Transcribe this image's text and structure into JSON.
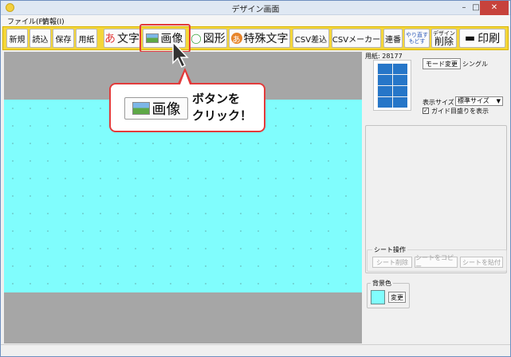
{
  "window": {
    "title": "デザイン画面",
    "minimize": "–",
    "maximize": "□",
    "close": "✕"
  },
  "menu": [
    "ファイル(F)",
    "情報(I)"
  ],
  "toolbar": {
    "new": "新規",
    "load": "読込",
    "save": "保存",
    "paper": "用紙",
    "text_icon": "あ",
    "text": "文字",
    "image": "画像",
    "shape_icon": "◯",
    "shape": "図形",
    "special_icon": "あ",
    "special_text": "特殊文字",
    "csv_merge": "CSV差込",
    "csv_maker": "CSVメーカー",
    "serial": "連番",
    "redo": "やり直す",
    "undo": "もどす",
    "design_label": "デザイン",
    "delete": "削除",
    "print_icon": "▬",
    "print": "印刷"
  },
  "callout": {
    "button_label": "画像",
    "line1": "ボタンを",
    "line2": "クリック！"
  },
  "side": {
    "paper_label": "用紙: 28177",
    "mode_button": "モード変更",
    "mode_value": "シングル",
    "display_size_label": "表示サイズ",
    "display_size_value": "標準サイズ",
    "guide_checkbox_label": "ガイド目盛りを表示",
    "guide_checked": true,
    "sheet_ops_label": "シート操作",
    "sheet_delete": "シート削除",
    "sheet_copy": "シートをコピー",
    "sheet_paste": "シートを貼付",
    "bg_color_label": "背景色",
    "bg_color_value": "#80fdfd",
    "bg_change": "変更"
  },
  "colors": {
    "toolbar_bg": "#f4d63a",
    "highlight": "#e23b3b",
    "paper": "#80fdfd",
    "canvas_bg": "#a6a6a6"
  }
}
